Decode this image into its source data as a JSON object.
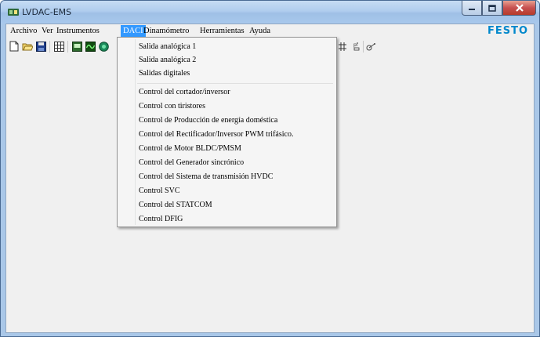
{
  "window": {
    "title": "LVDAC-EMS",
    "brand_logo": "FESTO",
    "brand_color": "#0088cc",
    "controls": {
      "minimize": "minimize-icon",
      "maximize": "maximize-icon",
      "close": "close-icon"
    }
  },
  "menubar": {
    "items": [
      {
        "label": "Archivo"
      },
      {
        "label": "Ver"
      },
      {
        "label": "Instrumentos"
      },
      {
        "label": "DACI",
        "active": true
      },
      {
        "label": "Dinamómetro"
      },
      {
        "label": "Herramientas"
      },
      {
        "label": "Ayuda"
      }
    ],
    "active_color": "#3399ff"
  },
  "toolbar": {
    "icons": [
      "new-file-icon",
      "open-folder-icon",
      "save-disk-icon",
      "grid-table-icon",
      "meter-icon",
      "oscilloscope-icon",
      "phasor-icon",
      "flip-icon",
      "pf-icon",
      "phase-icon"
    ],
    "labels": {
      "pf": "pf\nn"
    }
  },
  "daci_menu": {
    "items_group1": [
      "Salida analógica 1",
      "Salida analógica 2",
      "Salidas digitales"
    ],
    "items_group2": [
      "Control del cortador/inversor",
      "Control con tiristores",
      "Control de Producción de energía doméstica",
      "Control del Rectificador/Inversor PWM trifásico.",
      "Control de Motor BLDC/PMSM",
      "Control del Generador sincrónico",
      "Control del Sistema de transmisión HVDC",
      "Control SVC",
      "Control del STATCOM",
      "Control DFIG"
    ]
  }
}
